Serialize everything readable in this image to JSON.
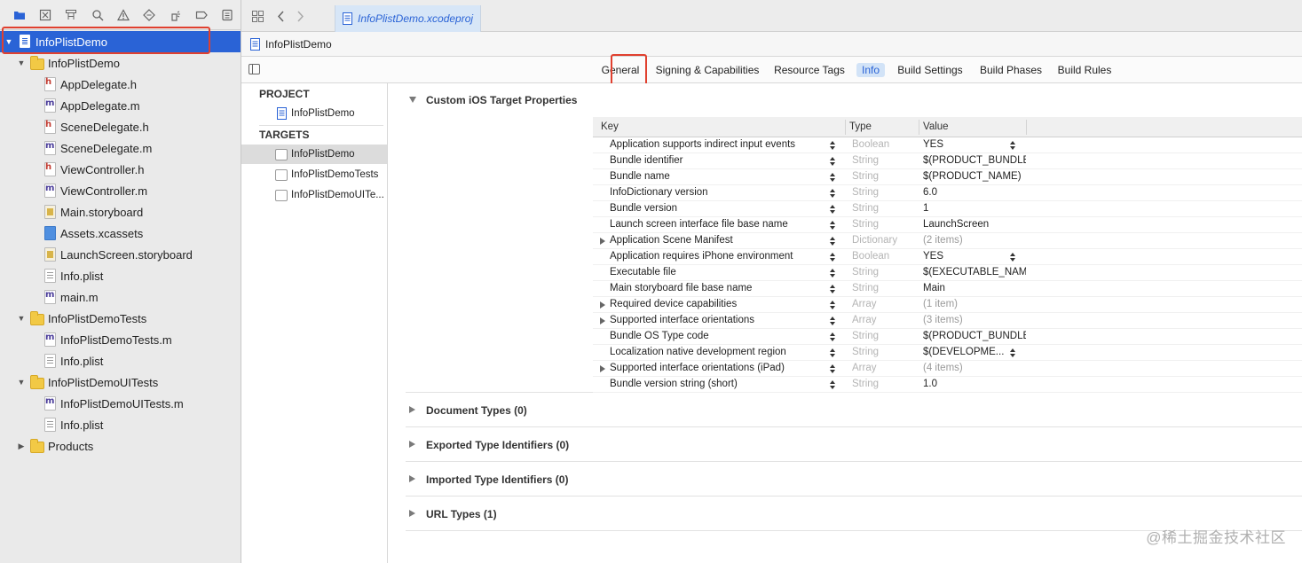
{
  "project_tab": "InfoPlistDemo.xcodeproj",
  "jump_bar": {
    "project": "InfoPlistDemo"
  },
  "navigator": {
    "rows": [
      {
        "label": "InfoPlistDemo",
        "kind": "project",
        "depth": 0,
        "disclosure": "open",
        "selected": true
      },
      {
        "label": "InfoPlistDemo",
        "kind": "folder",
        "depth": 1,
        "disclosure": "open"
      },
      {
        "label": "AppDelegate.h",
        "kind": "h",
        "depth": 2
      },
      {
        "label": "AppDelegate.m",
        "kind": "m",
        "depth": 2
      },
      {
        "label": "SceneDelegate.h",
        "kind": "h",
        "depth": 2
      },
      {
        "label": "SceneDelegate.m",
        "kind": "m",
        "depth": 2
      },
      {
        "label": "ViewController.h",
        "kind": "h",
        "depth": 2
      },
      {
        "label": "ViewController.m",
        "kind": "m",
        "depth": 2
      },
      {
        "label": "Main.storyboard",
        "kind": "storyboard",
        "depth": 2
      },
      {
        "label": "Assets.xcassets",
        "kind": "assets",
        "depth": 2
      },
      {
        "label": "LaunchScreen.storyboard",
        "kind": "storyboard",
        "depth": 2
      },
      {
        "label": "Info.plist",
        "kind": "plist",
        "depth": 2
      },
      {
        "label": "main.m",
        "kind": "m",
        "depth": 2
      },
      {
        "label": "InfoPlistDemoTests",
        "kind": "folder",
        "depth": 1,
        "disclosure": "open"
      },
      {
        "label": "InfoPlistDemoTests.m",
        "kind": "m",
        "depth": 2
      },
      {
        "label": "Info.plist",
        "kind": "plist",
        "depth": 2
      },
      {
        "label": "InfoPlistDemoUITests",
        "kind": "folder",
        "depth": 1,
        "disclosure": "open"
      },
      {
        "label": "InfoPlistDemoUITests.m",
        "kind": "m",
        "depth": 2
      },
      {
        "label": "Info.plist",
        "kind": "plist",
        "depth": 2
      },
      {
        "label": "Products",
        "kind": "folder",
        "depth": 1,
        "disclosure": "closed"
      }
    ]
  },
  "segments": {
    "general": "General",
    "signing": "Signing & Capabilities",
    "resource_tags": "Resource Tags",
    "info": "Info",
    "build_settings": "Build Settings",
    "build_phases": "Build Phases",
    "build_rules": "Build Rules"
  },
  "targets_panel": {
    "project_header": "PROJECT",
    "project_item": "InfoPlistDemo",
    "targets_header": "TARGETS",
    "targets": [
      "InfoPlistDemo",
      "InfoPlistDemoTests",
      "InfoPlistDemoUITe..."
    ]
  },
  "sections": {
    "custom_props": "Custom iOS Target Properties",
    "document_types": "Document Types (0)",
    "exported_types": "Exported Type Identifiers (0)",
    "imported_types": "Imported Type Identifiers (0)",
    "url_types": "URL Types (1)"
  },
  "plist_table": {
    "headers": {
      "key": "Key",
      "type": "Type",
      "value": "Value"
    },
    "rows": [
      {
        "key": "Application supports indirect input events",
        "type": "Boolean",
        "value": "YES",
        "expandable": false,
        "value_stepper": true,
        "dim": false
      },
      {
        "key": "Bundle identifier",
        "type": "String",
        "value": "$(PRODUCT_BUNDLE_IDENTIFIER)",
        "expandable": false,
        "value_stepper": false,
        "dim": false
      },
      {
        "key": "Bundle name",
        "type": "String",
        "value": "$(PRODUCT_NAME)",
        "expandable": false,
        "value_stepper": false,
        "dim": false
      },
      {
        "key": "InfoDictionary version",
        "type": "String",
        "value": "6.0",
        "expandable": false,
        "value_stepper": false,
        "dim": false
      },
      {
        "key": "Bundle version",
        "type": "String",
        "value": "1",
        "expandable": false,
        "value_stepper": false,
        "dim": false
      },
      {
        "key": "Launch screen interface file base name",
        "type": "String",
        "value": "LaunchScreen",
        "expandable": false,
        "value_stepper": false,
        "dim": false
      },
      {
        "key": "Application Scene Manifest",
        "type": "Dictionary",
        "value": "(2 items)",
        "expandable": true,
        "value_stepper": false,
        "dim": true
      },
      {
        "key": "Application requires iPhone environment",
        "type": "Boolean",
        "value": "YES",
        "expandable": false,
        "value_stepper": true,
        "dim": false
      },
      {
        "key": "Executable file",
        "type": "String",
        "value": "$(EXECUTABLE_NAME)",
        "expandable": false,
        "value_stepper": false,
        "dim": false
      },
      {
        "key": "Main storyboard file base name",
        "type": "String",
        "value": "Main",
        "expandable": false,
        "value_stepper": false,
        "dim": false
      },
      {
        "key": "Required device capabilities",
        "type": "Array",
        "value": "(1 item)",
        "expandable": true,
        "value_stepper": false,
        "dim": true
      },
      {
        "key": "Supported interface orientations",
        "type": "Array",
        "value": "(3 items)",
        "expandable": true,
        "value_stepper": false,
        "dim": true
      },
      {
        "key": "Bundle OS Type code",
        "type": "String",
        "value": "$(PRODUCT_BUNDLE_PACKAGE_TYPE)",
        "expandable": false,
        "value_stepper": false,
        "dim": false
      },
      {
        "key": "Localization native development region",
        "type": "String",
        "value": "$(DEVELOPME...",
        "expandable": false,
        "value_stepper": true,
        "dim": false
      },
      {
        "key": "Supported interface orientations (iPad)",
        "type": "Array",
        "value": "(4 items)",
        "expandable": true,
        "value_stepper": false,
        "dim": true
      },
      {
        "key": "Bundle version string (short)",
        "type": "String",
        "value": "1.0",
        "expandable": false,
        "value_stepper": false,
        "dim": false
      }
    ]
  },
  "watermark": "@稀土掘金技术社区",
  "colors": {
    "selection": "#2a63d6",
    "highlight_box": "#e0402f",
    "tab_active_bg": "#d7e6f7"
  }
}
